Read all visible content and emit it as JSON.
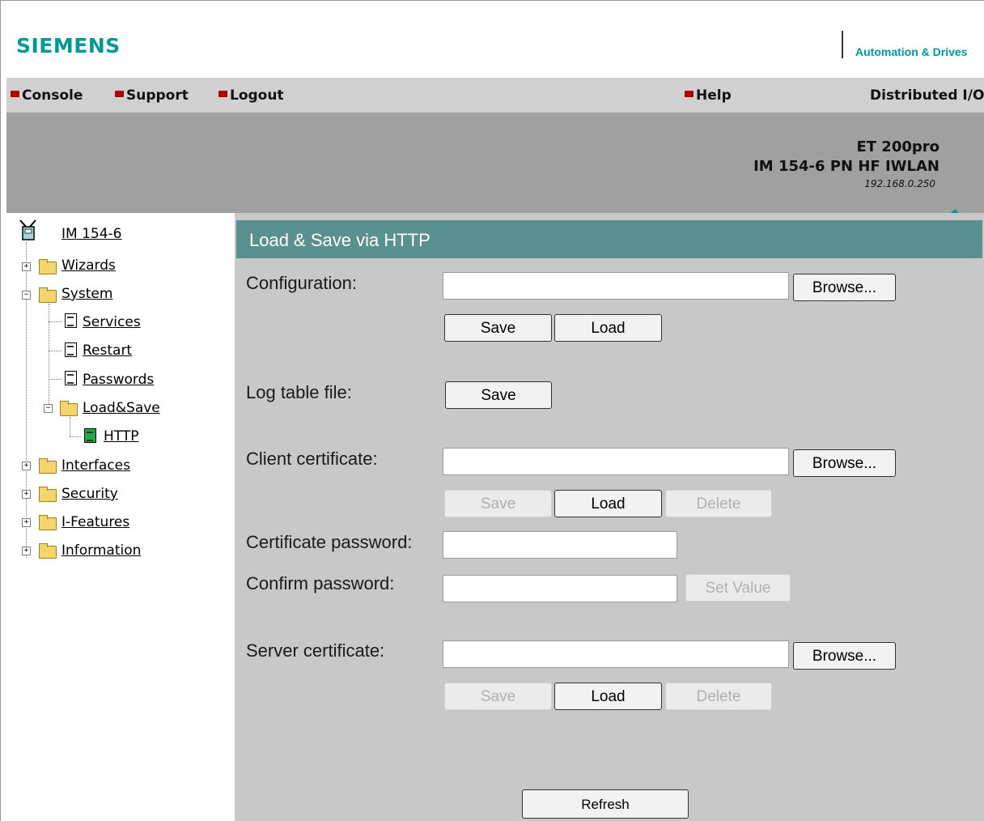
{
  "header": {
    "logo": "SIEMENS",
    "brand": "Automation & Drives",
    "product_line1": "ET 200pro",
    "product_line2": "IM 154-6 PN HF IWLAN",
    "ip": "192.168.0.250"
  },
  "menu": {
    "console": "Console",
    "support": "Support",
    "logout": "Logout",
    "help": "Help",
    "section": "Distributed I/O"
  },
  "tree": {
    "root": "IM 154-6",
    "wizards": "Wizards",
    "system": "System",
    "services": "Services",
    "restart": "Restart",
    "passwords": "Passwords",
    "loadsave": "Load&Save",
    "http": "HTTP",
    "interfaces": "Interfaces",
    "security": "Security",
    "ifeatures": "I-Features",
    "information": "Information"
  },
  "page": {
    "title": "Load & Save via HTTP",
    "configuration_label": "Configuration:",
    "logtable_label": "Log table file:",
    "client_cert_label": "Client certificate:",
    "cert_password_label": "Certificate password:",
    "confirm_password_label": "Confirm password:",
    "server_cert_label": "Server certificate:",
    "browse": "Browse...",
    "save": "Save",
    "load": "Load",
    "delete": "Delete",
    "set_value": "Set Value",
    "refresh": "Refresh"
  }
}
